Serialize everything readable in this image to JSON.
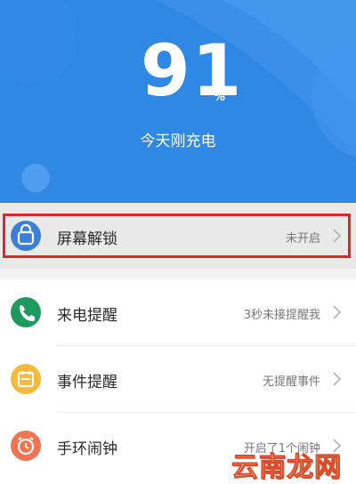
{
  "battery": {
    "level": "91",
    "unit": "%",
    "status": "今天刚充电"
  },
  "list": [
    {
      "name": "screen-unlock",
      "icon": "lock-icon",
      "icon_color": "#3b7fd9",
      "label": "屏幕解锁",
      "value": "未开启",
      "selected": true
    },
    {
      "name": "incoming-call-alert",
      "icon": "phone-icon",
      "icon_color": "#1e9a5f",
      "label": "来电提醒",
      "value": "3秒未接提醒我",
      "selected": false
    },
    {
      "name": "event-reminder",
      "icon": "calendar-icon",
      "icon_color": "#f5b93b",
      "label": "事件提醒",
      "value": "无提醒事件",
      "selected": false
    },
    {
      "name": "band-alarm",
      "icon": "alarm-clock-icon",
      "icon_color": "#f2744f",
      "label": "手环闹钟",
      "value": "开启了1个闹钟",
      "selected": false
    }
  ],
  "watermark": "云南龙网",
  "colors": {
    "header": "#2f88e4",
    "highlight": "#e0262b"
  }
}
